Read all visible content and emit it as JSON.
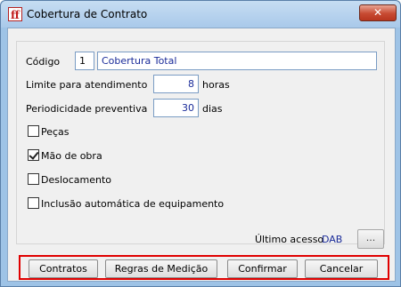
{
  "window": {
    "title": "Cobertura de Contrato",
    "close_symbol": "✕",
    "app_icon": "ff-logo-icon",
    "app_icon_text": "ff"
  },
  "form": {
    "codigo_label": "Código",
    "codigo_value": "1",
    "descricao_value": "Cobertura Total",
    "limite_label": "Limite para atendimento",
    "limite_value": "8",
    "limite_unit": "horas",
    "periodicidade_label": "Periodicidade preventiva",
    "periodicidade_value": "30",
    "periodicidade_unit": "dias",
    "checkboxes": [
      {
        "label": "Peças",
        "checked": false
      },
      {
        "label": "Mão de obra",
        "checked": true
      },
      {
        "label": "Deslocamento",
        "checked": false
      },
      {
        "label": "Inclusão automática de equipamento",
        "checked": false
      }
    ]
  },
  "footer": {
    "ultimo_acesso_label": "Último acesso",
    "ultimo_acesso_value": "DAB",
    "browse_label": "..."
  },
  "buttons": {
    "contratos": "Contratos",
    "regras": "Regras de Medição",
    "confirmar": "Confirmar",
    "cancelar": "Cancelar"
  },
  "colors": {
    "highlight_frame": "#e00000",
    "value_text": "#1a2b99",
    "titlebar": "#a9c9ea"
  }
}
